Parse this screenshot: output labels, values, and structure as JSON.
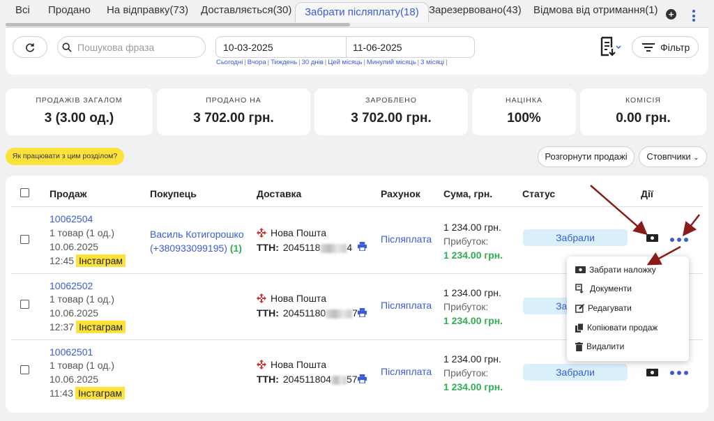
{
  "tabs": [
    {
      "label": "Всі"
    },
    {
      "label": "Продано"
    },
    {
      "label": "На відправку(73)"
    },
    {
      "label": "Доставляється(30)"
    },
    {
      "label": "Забрати післяплату(18)"
    },
    {
      "label": "Зарезервовано(43)"
    },
    {
      "label": "Відмова від отримання(1)"
    }
  ],
  "filters": {
    "search_placeholder": "Пошукова фраза",
    "date_from": "10-03-2025",
    "date_to": "11-06-2025",
    "quick": [
      "Сьогодні",
      "Вчора",
      "Тиждень",
      "30 днів",
      "Цей місяць",
      "Минулий місяць",
      "3 місяці"
    ],
    "filter_label": "Фільтр"
  },
  "stats": [
    {
      "label": "ПРОДАЖІВ ЗАГАЛОМ",
      "value": "3 (3.00 од.)"
    },
    {
      "label": "ПРОДАНО НА",
      "value": "3 702.00 грн."
    },
    {
      "label": "ЗАРОБЛЕНО",
      "value": "3 702.00 грн."
    },
    {
      "label": "НАЦІНКА",
      "value": "100%"
    },
    {
      "label": "КОМІСІЯ",
      "value": "0.00 грн."
    }
  ],
  "actions": {
    "help": "Як працювати з цим розділом?",
    "expand": "Розгорнути продажі",
    "columns": "Стовпчики"
  },
  "table": {
    "headers": {
      "sale": "Продаж",
      "buyer": "Покупець",
      "delivery": "Доставка",
      "invoice": "Рахунок",
      "sum": "Сума, грн.",
      "status": "Статус",
      "actions": "Дії"
    },
    "rows": [
      {
        "id": "10062504",
        "items": "1 товар (1 од.)",
        "date": "10.06.2025",
        "time": "12:45",
        "source": "Інстаграм",
        "buyer_name": "Василь Котигорошко",
        "buyer_phone": "(+380933099195)",
        "buyer_count": "(1)",
        "carrier": "Нова Пошта",
        "ttn_label": "ТТН:",
        "ttn_start": "2045118",
        "ttn_end": "4",
        "invoice": "Післяплата",
        "sum": "1 234.00 грн.",
        "profit_label": "Прибуток:",
        "profit": "1 234.00 грн.",
        "status": "Забрали"
      },
      {
        "id": "10062502",
        "items": "1 товар (1 од.)",
        "date": "10.06.2025",
        "time": "12:37",
        "source": "Інстаграм",
        "buyer_name": "",
        "buyer_phone": "",
        "buyer_count": "",
        "carrier": "Нова Пошта",
        "ttn_label": "ТТН:",
        "ttn_start": "20451180",
        "ttn_end": "7",
        "invoice": "Післяплата",
        "sum": "1 234.00 грн.",
        "profit_label": "Прибуток:",
        "profit": "1 234.00 грн.",
        "status": "Забрали"
      },
      {
        "id": "10062501",
        "items": "1 товар (1 од.)",
        "date": "10.06.2025",
        "time": "11:43",
        "source": "Інстаграм",
        "buyer_name": "",
        "buyer_phone": "",
        "buyer_count": "",
        "carrier": "Нова Пошта",
        "ttn_label": "ТТН:",
        "ttn_start": "204511804",
        "ttn_end": "57",
        "invoice": "Післяплата",
        "sum": "1 234.00 грн.",
        "profit_label": "Прибуток:",
        "profit": "1 234.00 грн.",
        "status": "Забрали"
      }
    ]
  },
  "dropdown": [
    {
      "label": "Забрати наложку",
      "icon": "cash-icon"
    },
    {
      "label": "Документи",
      "icon": "document-icon"
    },
    {
      "label": "Редагувати",
      "icon": "edit-icon"
    },
    {
      "label": "Копіювати продаж",
      "icon": "copy-icon"
    },
    {
      "label": "Видалити",
      "icon": "trash-icon"
    }
  ],
  "colors": {
    "accent": "#3a5bd9",
    "badge": "#fde23c",
    "profit": "#2fae4f",
    "status_bg": "#d9f0fb",
    "arrow": "#8b1a1a"
  }
}
